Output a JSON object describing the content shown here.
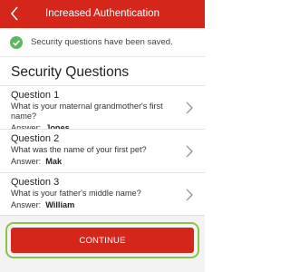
{
  "header": {
    "title": "Increased Authentication",
    "back_icon": "chevron-left-icon",
    "background_color": "#d5261c"
  },
  "notice": {
    "icon": "check-circle-icon",
    "icon_color": "#5cb85c",
    "text": "Security questions have been saved."
  },
  "section": {
    "title": "Security Questions"
  },
  "questions": [
    {
      "title": "Question 1",
      "text": "What is your maternal grandmother's first name?",
      "answer_label": "Answer:",
      "answer": "Jones"
    },
    {
      "title": "Question 2",
      "text": "What was the name of your first pet?",
      "answer_label": "Answer:",
      "answer": "Mak"
    },
    {
      "title": "Question 3",
      "text": "What is your father's middle name?",
      "answer_label": "Answer:",
      "answer": "William"
    }
  ],
  "footer": {
    "continue_label": "CONTINUE",
    "button_color": "#d5261c",
    "highlight_color": "#8bc34a"
  }
}
